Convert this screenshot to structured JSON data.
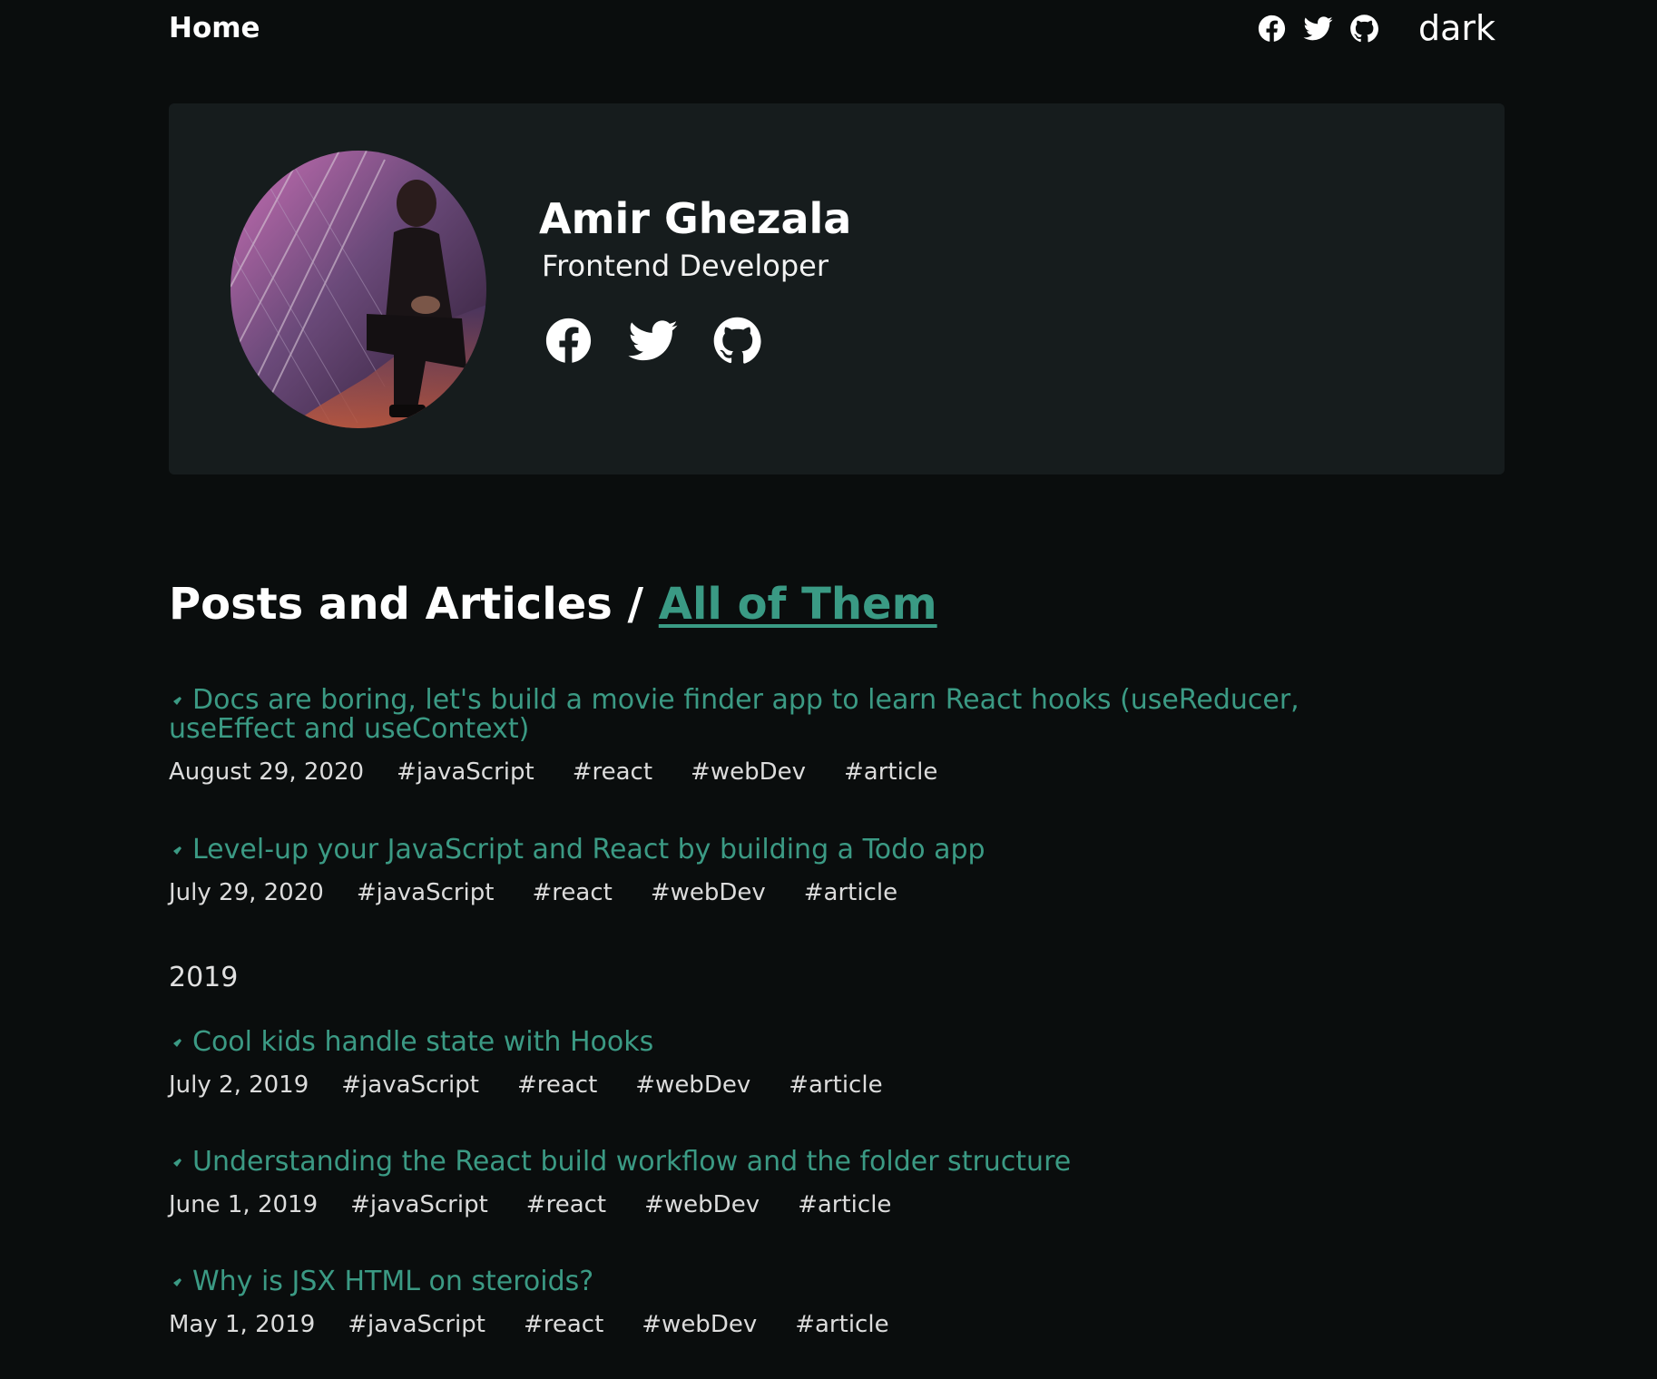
{
  "nav": {
    "home": "Home",
    "theme": "dark",
    "icons": [
      "facebook-icon",
      "twitter-icon",
      "github-icon"
    ]
  },
  "hero": {
    "name": "Amir Ghezala",
    "role": "Frontend Developer",
    "icons": [
      "facebook-icon",
      "twitter-icon",
      "github-icon"
    ]
  },
  "posts": {
    "heading": "Posts and Articles /",
    "filter": "All of Them",
    "year_2019": "2019",
    "items": [
      {
        "title": "Docs are boring, let's build a movie finder app to learn React hooks (useReducer, useEffect and useContext)",
        "date": "August 29, 2020",
        "tags": [
          "#javaScript",
          "#react",
          "#webDev",
          "#article"
        ]
      },
      {
        "title": "Level-up your JavaScript and React by building a Todo app",
        "date": "July 29, 2020",
        "tags": [
          "#javaScript",
          "#react",
          "#webDev",
          "#article"
        ]
      },
      {
        "title": "Cool kids handle state with Hooks",
        "date": "July 2, 2019",
        "tags": [
          "#javaScript",
          "#react",
          "#webDev",
          "#article"
        ]
      },
      {
        "title": "Understanding the React build workflow and the folder structure",
        "date": "June 1, 2019",
        "tags": [
          "#javaScript",
          "#react",
          "#webDev",
          "#article"
        ]
      },
      {
        "title": "Why is JSX HTML on steroids?",
        "date": "May 1, 2019",
        "tags": [
          "#javaScript",
          "#react",
          "#webDev",
          "#article"
        ]
      }
    ]
  },
  "colors": {
    "background": "#0a0d0d",
    "card": "#161c1d",
    "accent": "#3b9a84",
    "text": "#ffffff"
  }
}
